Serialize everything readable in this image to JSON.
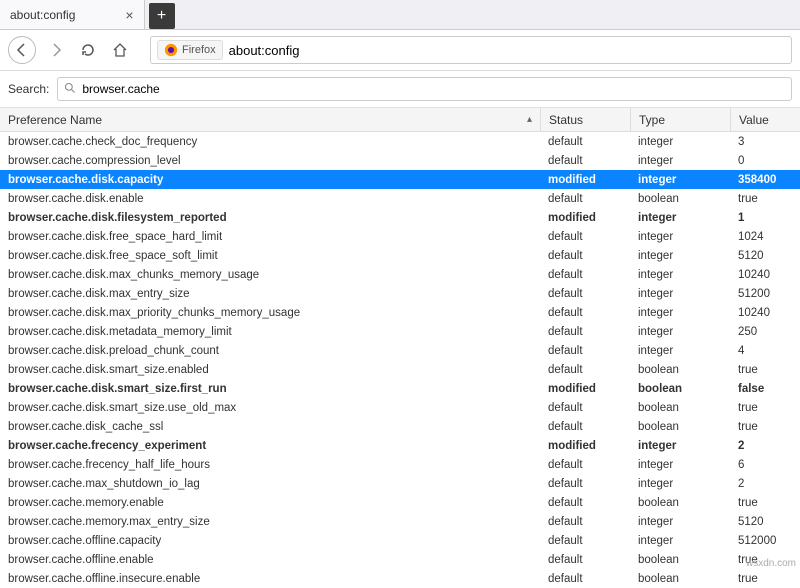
{
  "tab": {
    "title": "about:config"
  },
  "urlbar": {
    "brand": "Firefox",
    "url": "about:config"
  },
  "search": {
    "label": "Search:",
    "value": "browser.cache"
  },
  "columns": {
    "name": "Preference Name",
    "status": "Status",
    "type": "Type",
    "value": "Value"
  },
  "rows": [
    {
      "name": "browser.cache.check_doc_frequency",
      "status": "default",
      "type": "integer",
      "value": "3",
      "bold": false,
      "sel": false
    },
    {
      "name": "browser.cache.compression_level",
      "status": "default",
      "type": "integer",
      "value": "0",
      "bold": false,
      "sel": false
    },
    {
      "name": "browser.cache.disk.capacity",
      "status": "modified",
      "type": "integer",
      "value": "358400",
      "bold": true,
      "sel": true
    },
    {
      "name": "browser.cache.disk.enable",
      "status": "default",
      "type": "boolean",
      "value": "true",
      "bold": false,
      "sel": false
    },
    {
      "name": "browser.cache.disk.filesystem_reported",
      "status": "modified",
      "type": "integer",
      "value": "1",
      "bold": true,
      "sel": false
    },
    {
      "name": "browser.cache.disk.free_space_hard_limit",
      "status": "default",
      "type": "integer",
      "value": "1024",
      "bold": false,
      "sel": false
    },
    {
      "name": "browser.cache.disk.free_space_soft_limit",
      "status": "default",
      "type": "integer",
      "value": "5120",
      "bold": false,
      "sel": false
    },
    {
      "name": "browser.cache.disk.max_chunks_memory_usage",
      "status": "default",
      "type": "integer",
      "value": "10240",
      "bold": false,
      "sel": false
    },
    {
      "name": "browser.cache.disk.max_entry_size",
      "status": "default",
      "type": "integer",
      "value": "51200",
      "bold": false,
      "sel": false
    },
    {
      "name": "browser.cache.disk.max_priority_chunks_memory_usage",
      "status": "default",
      "type": "integer",
      "value": "10240",
      "bold": false,
      "sel": false
    },
    {
      "name": "browser.cache.disk.metadata_memory_limit",
      "status": "default",
      "type": "integer",
      "value": "250",
      "bold": false,
      "sel": false
    },
    {
      "name": "browser.cache.disk.preload_chunk_count",
      "status": "default",
      "type": "integer",
      "value": "4",
      "bold": false,
      "sel": false
    },
    {
      "name": "browser.cache.disk.smart_size.enabled",
      "status": "default",
      "type": "boolean",
      "value": "true",
      "bold": false,
      "sel": false
    },
    {
      "name": "browser.cache.disk.smart_size.first_run",
      "status": "modified",
      "type": "boolean",
      "value": "false",
      "bold": true,
      "sel": false
    },
    {
      "name": "browser.cache.disk.smart_size.use_old_max",
      "status": "default",
      "type": "boolean",
      "value": "true",
      "bold": false,
      "sel": false
    },
    {
      "name": "browser.cache.disk_cache_ssl",
      "status": "default",
      "type": "boolean",
      "value": "true",
      "bold": false,
      "sel": false
    },
    {
      "name": "browser.cache.frecency_experiment",
      "status": "modified",
      "type": "integer",
      "value": "2",
      "bold": true,
      "sel": false
    },
    {
      "name": "browser.cache.frecency_half_life_hours",
      "status": "default",
      "type": "integer",
      "value": "6",
      "bold": false,
      "sel": false
    },
    {
      "name": "browser.cache.max_shutdown_io_lag",
      "status": "default",
      "type": "integer",
      "value": "2",
      "bold": false,
      "sel": false
    },
    {
      "name": "browser.cache.memory.enable",
      "status": "default",
      "type": "boolean",
      "value": "true",
      "bold": false,
      "sel": false
    },
    {
      "name": "browser.cache.memory.max_entry_size",
      "status": "default",
      "type": "integer",
      "value": "5120",
      "bold": false,
      "sel": false
    },
    {
      "name": "browser.cache.offline.capacity",
      "status": "default",
      "type": "integer",
      "value": "512000",
      "bold": false,
      "sel": false
    },
    {
      "name": "browser.cache.offline.enable",
      "status": "default",
      "type": "boolean",
      "value": "true",
      "bold": false,
      "sel": false
    },
    {
      "name": "browser.cache.offline.insecure.enable",
      "status": "default",
      "type": "boolean",
      "value": "true",
      "bold": false,
      "sel": false
    }
  ],
  "watermark": "wsxdn.com"
}
